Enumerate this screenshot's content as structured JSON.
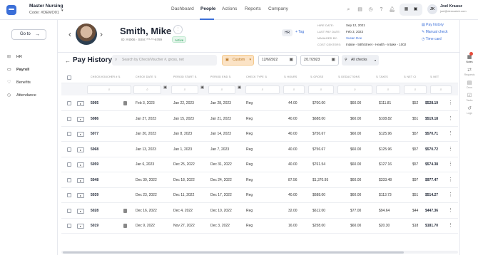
{
  "company": {
    "name": "Master Nursing",
    "code": "Code: #DEMO01"
  },
  "nav": {
    "dashboard": "Dashboard",
    "people": "People",
    "actions": "Actions",
    "reports": "Reports",
    "company": "Company"
  },
  "user": {
    "initials": "JK",
    "name": "Joel Krausz",
    "email": "joel@demoatch.com"
  },
  "sidebar": {
    "goto": "Go to",
    "items": [
      "HR",
      "Payroll",
      "Benefits",
      "Attendance"
    ]
  },
  "employee": {
    "name": "Smith, Mike",
    "meta": "ID: #4006  ·  SSN: ***-**-6789",
    "status": "Active",
    "hr_badge": "HR",
    "tag_link": "+ Tag"
  },
  "info": {
    "hire_date_label": "HIRE DATE:",
    "hire_date": "Sep 12, 2021",
    "last_pay_label": "LAST PAY DATE:",
    "last_pay": "Feb 3, 2023",
    "managed_label": "MANAGED BY:",
    "managed": "Susan Doe",
    "cost_label": "COST CENTERS:",
    "cost": "Intake - 58thStreet - Health - Intake - 1002"
  },
  "quick_links": [
    "Pay history",
    "Manual check",
    "Time card"
  ],
  "rail": [
    "Notes",
    "Requests",
    "Docs",
    "Tasks",
    "Logs"
  ],
  "pay_history": {
    "title": "Pay History",
    "search_placeholder": "Search by Check/Voucher #, gross, net",
    "range": "Custom",
    "date_from": "12/6/2022",
    "date_to": "2/17/2023",
    "checks_filter": "All checks"
  },
  "columns": [
    "CHECK/VOUCHER #",
    "CHECK DATE",
    "PERIOD START",
    "PERIOD END",
    "CHECK TYPE",
    "HOURS",
    "GROSS",
    "DEDUCTIONS",
    "TAXES",
    "NET CI",
    "NET"
  ],
  "rows": [
    {
      "num": "5095",
      "check_date": "Feb 3, 2023",
      "start": "Jan 22, 2023",
      "end": "Jan 28, 2023",
      "type": "Reg",
      "hours": "44.00",
      "gross": "$700.00",
      "ded": "$60.00",
      "taxes": "$111.81",
      "netci": "$52",
      "net": "$528.19",
      "attach": true
    },
    {
      "num": "5086",
      "check_date": "Jan 27, 2023",
      "start": "Jan 15, 2023",
      "end": "Jan 21, 2023",
      "type": "Reg",
      "hours": "40.00",
      "gross": "$688.00",
      "ded": "$60.00",
      "taxes": "$108.82",
      "netci": "$51",
      "net": "$519.18",
      "attach": false
    },
    {
      "num": "5077",
      "check_date": "Jan 20, 2023",
      "start": "Jan 8, 2023",
      "end": "Jan 14, 2023",
      "type": "Reg",
      "hours": "40.00",
      "gross": "$756.67",
      "ded": "$60.00",
      "taxes": "$125.96",
      "netci": "$57",
      "net": "$570.71",
      "attach": false
    },
    {
      "num": "5068",
      "check_date": "Jan 13, 2023",
      "start": "Jan 1, 2023",
      "end": "Jan 7, 2023",
      "type": "Reg",
      "hours": "40.00",
      "gross": "$756.67",
      "ded": "$60.00",
      "taxes": "$125.96",
      "netci": "$57",
      "net": "$570.72",
      "attach": false
    },
    {
      "num": "5059",
      "check_date": "Jan 6, 2023",
      "start": "Dec 25, 2022",
      "end": "Dec 31, 2022",
      "type": "Reg",
      "hours": "40.00",
      "gross": "$761.54",
      "ded": "$60.00",
      "taxes": "$127.16",
      "netci": "$57",
      "net": "$574.38",
      "attach": false
    },
    {
      "num": "5048",
      "check_date": "Dec 30, 2022",
      "start": "Dec 18, 2022",
      "end": "Dec 24, 2022",
      "type": "Reg",
      "hours": "87.56",
      "gross": "$1,370.95",
      "ded": "$60.00",
      "taxes": "$333.48",
      "netci": "$97",
      "net": "$977.47",
      "attach": false
    },
    {
      "num": "5039",
      "check_date": "Dec 23, 2022",
      "start": "Dec 11, 2022",
      "end": "Dec 17, 2022",
      "type": "Reg",
      "hours": "40.00",
      "gross": "$688.00",
      "ded": "$60.00",
      "taxes": "$113.73",
      "netci": "$51",
      "net": "$514.27",
      "attach": false
    },
    {
      "num": "5028",
      "check_date": "Dec 16, 2022",
      "start": "Dec 4, 2022",
      "end": "Dec 10, 2022",
      "type": "Reg",
      "hours": "32.00",
      "gross": "$612.00",
      "ded": "$77.00",
      "taxes": "$94.64",
      "netci": "$44",
      "net": "$447.36",
      "attach": true
    },
    {
      "num": "5019",
      "check_date": "Dec 9, 2022",
      "start": "Nov 27, 2022",
      "end": "Dec 3, 2022",
      "type": "Reg",
      "hours": "16.00",
      "gross": "$258.00",
      "ded": "$60.00",
      "taxes": "$20.30",
      "netci": "$18",
      "net": "$181.70",
      "attach": true
    }
  ]
}
